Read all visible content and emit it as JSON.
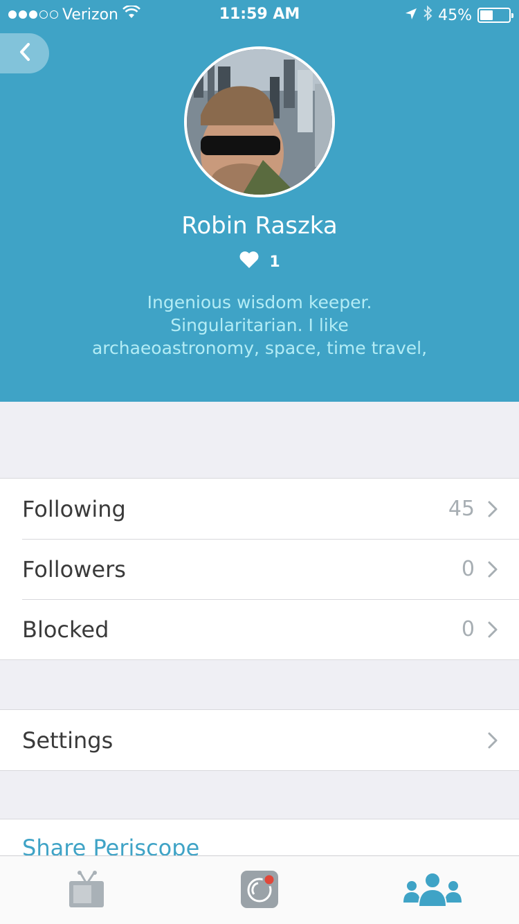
{
  "status_bar": {
    "carrier": "Verizon",
    "time": "11:59 AM",
    "battery": "45%",
    "battery_level": 0.45,
    "signal_bars": 3,
    "signal_total": 5
  },
  "profile": {
    "name": "Robin Raszka",
    "hearts": "1",
    "bio_lines": [
      "Ingenious wisdom keeper.",
      "Singularitarian. I like",
      "archaeoastronomy, space, time travel,"
    ]
  },
  "stats": [
    {
      "label": "Following",
      "value": "45"
    },
    {
      "label": "Followers",
      "value": "0"
    },
    {
      "label": "Blocked",
      "value": "0"
    }
  ],
  "settings": {
    "label": "Settings"
  },
  "share": {
    "label": "Share Periscope"
  },
  "tabs": [
    {
      "icon": "tv-icon",
      "active": false
    },
    {
      "icon": "broadcast-icon",
      "active": false
    },
    {
      "icon": "people-icon",
      "active": true
    }
  ],
  "colors": {
    "brand": "#3fa3c6",
    "bio_text": "#b3ecf5",
    "value_gray": "#a7aeb3",
    "record_red": "#e0473a"
  }
}
